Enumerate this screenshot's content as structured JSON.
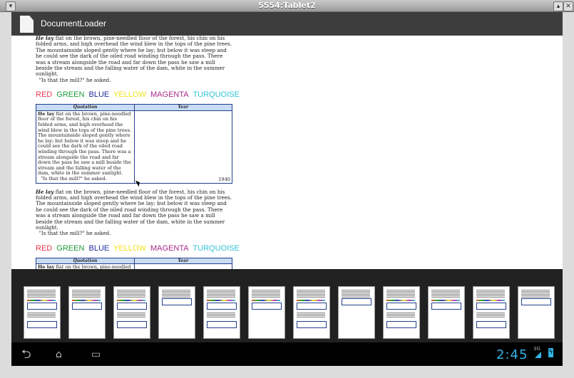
{
  "window": {
    "title": "5554:Tablet2"
  },
  "app": {
    "title": "DocumentLoader"
  },
  "document": {
    "paragraph_lead": "He lay",
    "paragraph_text": " flat on the brown, pine-needled floor of the forest, his chin on his folded arms, and high overhead the wind blew in the tops of the pine trees. The mountainside sloped gently where he lay; but below it was steep and he could see the dark of the oiled road winding through the pass. There was a stream alongside the road and far down the pass he saw a mill beside the stream and the falling water of the dam, white in the summer sunlight.",
    "quote_line": "\"Is that the mill?\" he asked.",
    "colors": [
      {
        "label": "RED",
        "color": "#e8374d"
      },
      {
        "label": "GREEN",
        "color": "#1f9a3a"
      },
      {
        "label": "BLUE",
        "color": "#232f9e"
      },
      {
        "label": "YELLOW",
        "color": "#f2e21a"
      },
      {
        "label": "MAGENTA",
        "color": "#a62a8b"
      },
      {
        "label": "TURQUOISE",
        "color": "#30c4d6"
      }
    ],
    "table": {
      "headers": [
        "Quotation",
        "Year"
      ],
      "year": "1940"
    }
  },
  "thumbnails": {
    "count": 12
  },
  "statusbar": {
    "time": "2:45",
    "network": "3G"
  },
  "icons": {
    "back": "back-arrow-icon",
    "home": "home-icon",
    "recents": "recent-apps-icon",
    "signal": "signal-icon",
    "battery": "battery-charging-icon"
  }
}
